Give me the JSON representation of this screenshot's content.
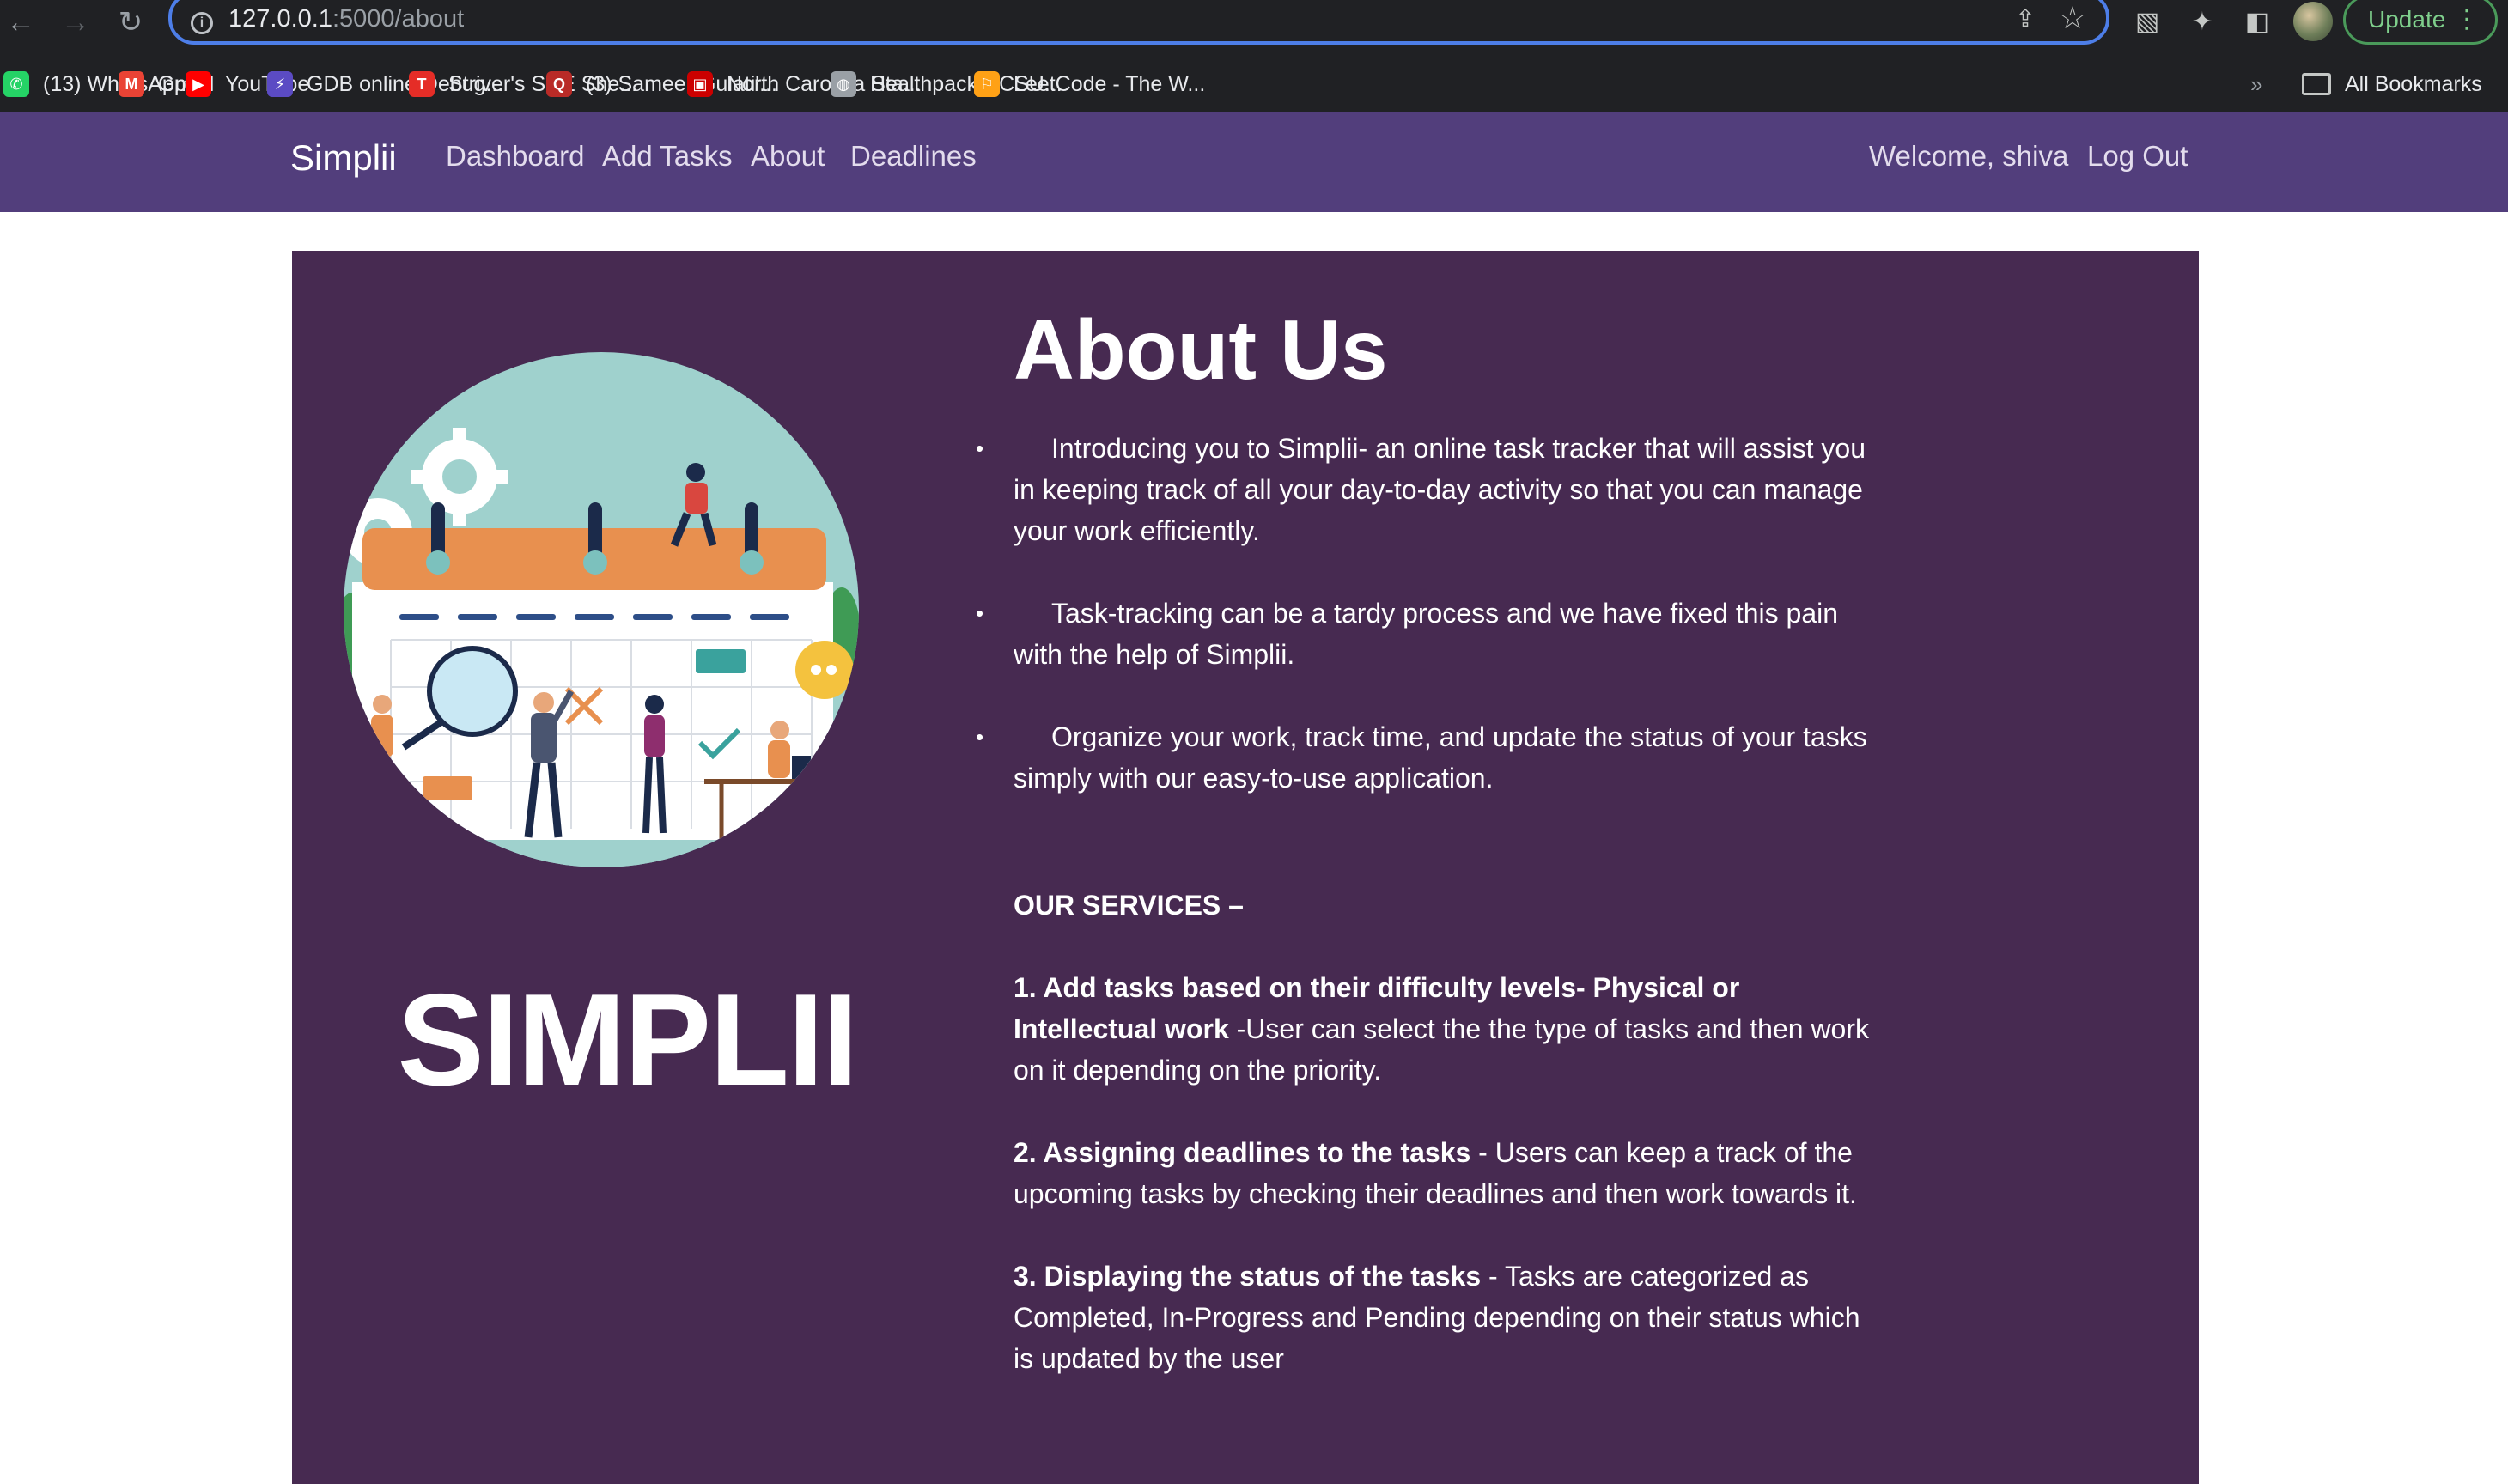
{
  "browser": {
    "url_host": "127.0.0.1",
    "url_path": ":5000/about",
    "update_label": "Update",
    "menu_dots": "⋮",
    "overflow_chevron": "»",
    "all_bookmarks_label": "All Bookmarks",
    "bookmarks": [
      {
        "label": "(13) WhatsApp",
        "icon": "whatsapp-icon",
        "color": "#25d366"
      },
      {
        "label": "Gmail",
        "icon": "gmail-icon",
        "color": "#ea4335"
      },
      {
        "label": "YouTube",
        "icon": "youtube-icon",
        "color": "#ff0000"
      },
      {
        "label": "GDB online Debug...",
        "icon": "gdb-icon",
        "color": "#5b4bc4"
      },
      {
        "label": "Striver's SDE She...",
        "icon": "striver-icon",
        "color": "#e52d27"
      },
      {
        "label": "(3) Sameer Gulati'...",
        "icon": "quora-icon",
        "color": "#b92b27"
      },
      {
        "label": "North Carolina Sta...",
        "icon": "ncsu-icon",
        "color": "#cc0000"
      },
      {
        "label": "Healthpack NCSU...",
        "icon": "globe-icon",
        "color": "#9aa0a6"
      },
      {
        "label": "LeetCode - The W...",
        "icon": "leetcode-icon",
        "color": "#ffa116"
      }
    ]
  },
  "site_nav": {
    "brand": "Simplii",
    "links": [
      "Dashboard",
      "Add Tasks",
      "About",
      "Deadlines"
    ],
    "welcome": "Welcome, shiva",
    "logout": "Log Out"
  },
  "about": {
    "title": "About Us",
    "logo_text": "SIMPLII",
    "bullets": [
      "Introducing you to Simplii- an online task tracker that will assist you in keeping track of all your day-to-day activity so that you can manage your work efficiently.",
      "Task-tracking can be a tardy process and we have fixed this pain with the help of Simplii.",
      "Organize your work, track time, and update the status of your tasks simply with our easy-to-use application."
    ],
    "services_heading": "OUR SERVICES –",
    "services": [
      {
        "title": "1. Add tasks based on their difficulty levels- Physical or Intellectual work",
        "text": " -User can select the the type of tasks and then work on it depending on the priority."
      },
      {
        "title": "2. Assigning deadlines to the tasks",
        "text": " - Users can keep a track of the upcoming tasks by checking their deadlines and then work towards it."
      },
      {
        "title": "3. Displaying the status of the tasks",
        "text": " - Tasks are categorized as Completed, In-Progress and Pending depending on their status which is updated by the user"
      }
    ]
  },
  "colors": {
    "navbar": "#523e7c",
    "card": "#472a51",
    "illustration_bg": "#9fd1cd",
    "calendar_header": "#e8904f"
  }
}
